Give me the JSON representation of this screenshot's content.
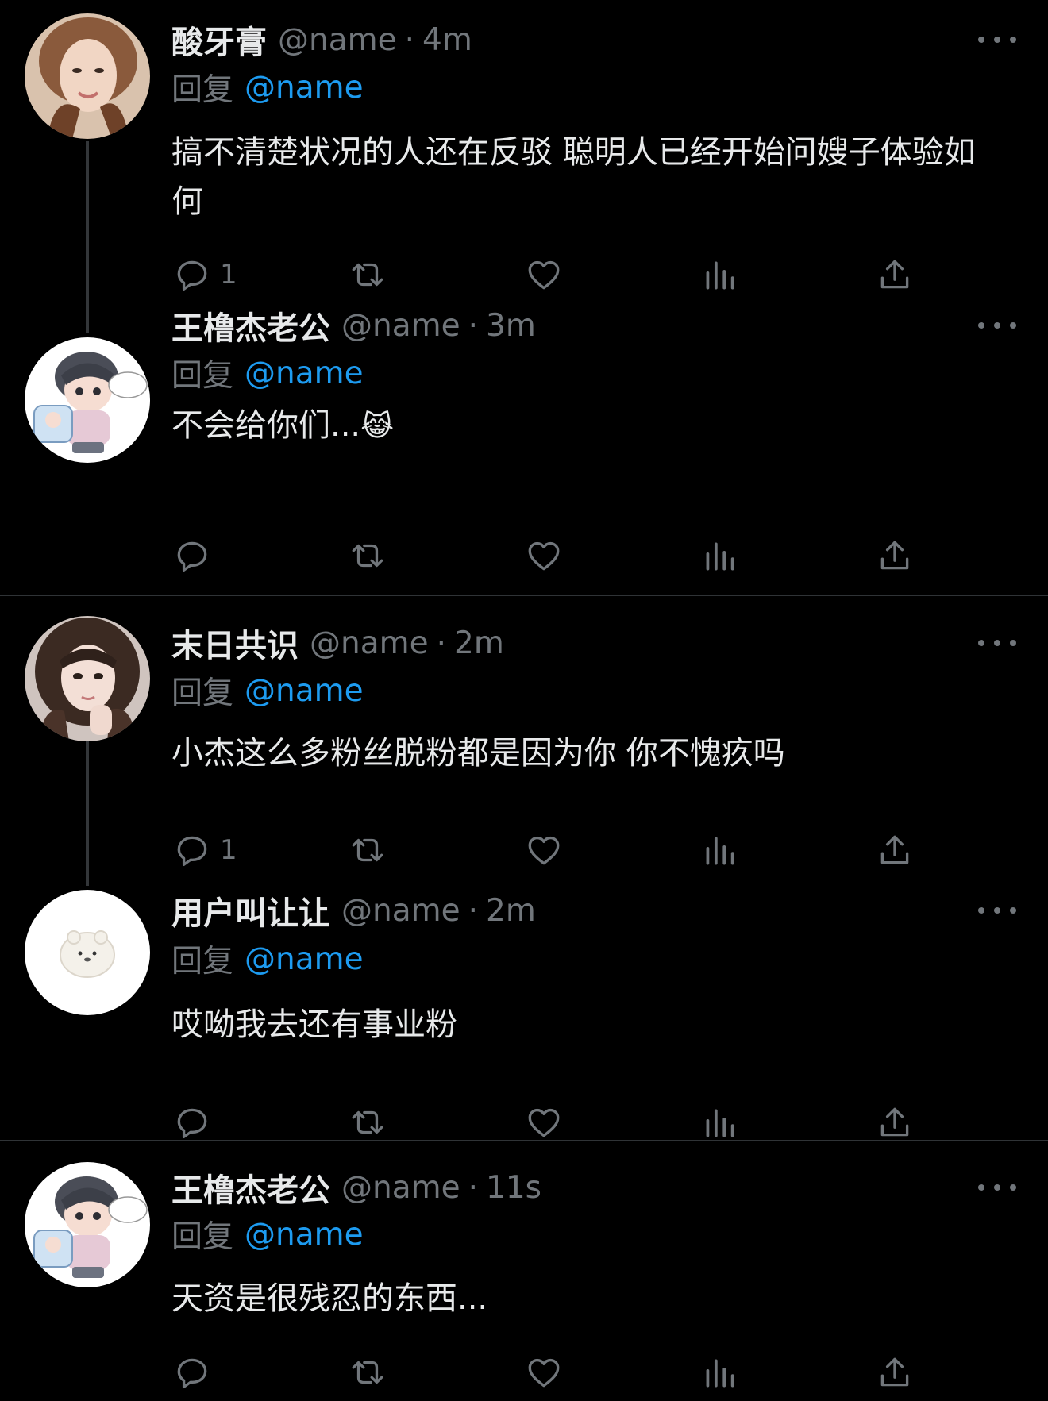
{
  "tweets": [
    {
      "name": "酸牙膏",
      "handle": "@name",
      "time": "4m",
      "reply_prefix": "回复",
      "reply_handle": "@name",
      "text": "搞不清楚状况的人还在反驳 聪明人已经开始问嫂子体验如何",
      "reply_count": "1",
      "avatar": "woman-photo"
    },
    {
      "name": "王橹杰老公",
      "handle": "@name",
      "time": "3m",
      "reply_prefix": "回复",
      "reply_handle": "@name",
      "text": "不会给你们...",
      "emoji": "😹",
      "reply_count": "",
      "avatar": "cartoon-boy"
    },
    {
      "name": "末日共识",
      "handle": "@name",
      "time": "2m",
      "reply_prefix": "回复",
      "reply_handle": "@name",
      "text": "小杰这么多粉丝脱粉都是因为你 你不愧疚吗",
      "reply_count": "1",
      "avatar": "girl-photo"
    },
    {
      "name": "用户叫让让",
      "handle": "@name",
      "time": "2m",
      "reply_prefix": "回复",
      "reply_handle": "@name",
      "text": "哎呦我去还有事业粉",
      "reply_count": "",
      "avatar": "white-bun"
    },
    {
      "name": "王橹杰老公",
      "handle": "@name",
      "time": "11s",
      "reply_prefix": "回复",
      "reply_handle": "@name",
      "text": "天资是很残忍的东西...",
      "reply_count": "",
      "avatar": "cartoon-boy"
    }
  ],
  "icons": {
    "reply": "reply-bubble-icon",
    "retweet": "retweet-icon",
    "like": "heart-icon",
    "views": "views-bar-chart-icon",
    "share": "share-upload-icon",
    "more": "more-dots-icon"
  },
  "colors": {
    "background": "#000000",
    "text": "#e7e9ea",
    "secondary": "#71767b",
    "link": "#1d9bf0",
    "divider": "#2f3336",
    "thread_line": "#333639"
  },
  "separator_dot": "·"
}
